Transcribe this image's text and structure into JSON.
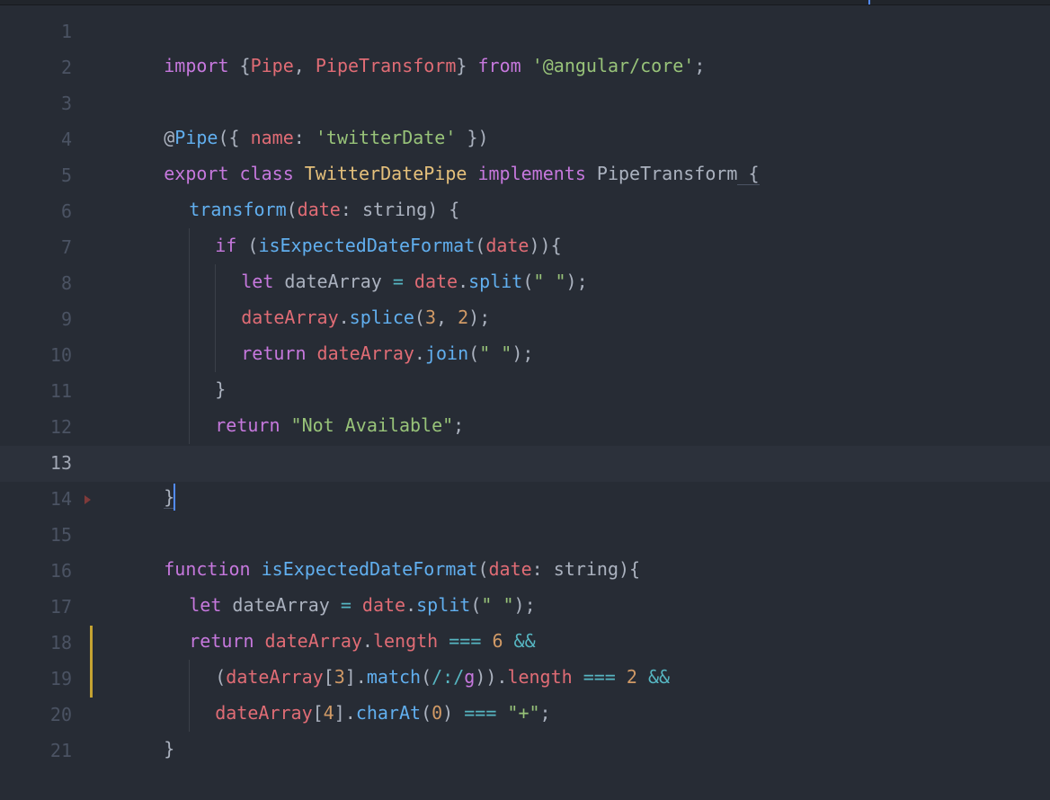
{
  "code": {
    "line_numbers": [
      "1",
      "2",
      "3",
      "4",
      "5",
      "6",
      "7",
      "8",
      "9",
      "10",
      "11",
      "12",
      "13",
      "14",
      "15",
      "16",
      "17",
      "18",
      "19",
      "20",
      "21"
    ],
    "active_line": 13,
    "lines": {
      "l1": {
        "import": "import",
        "lb": " {",
        "Pipe": "Pipe",
        "comma": ", ",
        "PipeTransform": "PipeTransform",
        "rb": "} ",
        "from": "from",
        "sp": " ",
        "str": "'@angular/core'",
        "semi": ";"
      },
      "l3": {
        "at": "@",
        "Pipe": "Pipe",
        "lp": "({ ",
        "name_kw": "name",
        "colon": ": ",
        "str": "'twitterDate'",
        "rp": " })"
      },
      "l4": {
        "export": "export",
        "class": " class ",
        "ClassName": "TwitterDatePipe",
        "implements": " implements ",
        "Iface": "PipeTransform",
        "lb": " {"
      },
      "l5": {
        "fn": "transform",
        "lp": "(",
        "arg": "date",
        "colon": ": ",
        "type": "string",
        "rp": ") {"
      },
      "l6": {
        "if": "if",
        "lp": " (",
        "fn": "isExpectedDateFormat",
        "lp2": "(",
        "arg": "date",
        "rp2": ")",
        "rp": "){"
      },
      "l7": {
        "let": "let",
        "var": " dateArray",
        "eq": " = ",
        "obj": "date",
        "dot": ".",
        "fn": "split",
        "lp": "(",
        "str": "\" \"",
        "rp": ");"
      },
      "l8": {
        "obj": "dateArray",
        "dot": ".",
        "fn": "splice",
        "lp": "(",
        "n1": "3",
        "comma": ", ",
        "n2": "2",
        "rp": ");"
      },
      "l9": {
        "return": "return",
        "obj": " dateArray",
        "dot": ".",
        "fn": "join",
        "lp": "(",
        "str": "\" \"",
        "rp": ");"
      },
      "l10": {
        "rb": "}"
      },
      "l11": {
        "return": "return",
        "sp": " ",
        "str": "\"Not Available\"",
        "semi": ";"
      },
      "l12": {
        "rb": "}"
      },
      "l13": {
        "rb": "}"
      },
      "l15": {
        "function": "function",
        "name": " isExpectedDateFormat",
        "lp": "(",
        "arg": "date",
        "colon": ": ",
        "type": "string",
        "rp": "){"
      },
      "l16": {
        "let": "let",
        "var": " dateArray",
        "eq": " = ",
        "obj": "date",
        "dot": ".",
        "fn": "split",
        "lp": "(",
        "str": "\" \"",
        "rp": ");"
      },
      "l17": {
        "return": "return",
        "obj": " dateArray",
        "dot": ".",
        "prop": "length",
        "eqeq": " === ",
        "n": "6",
        "and": " &&"
      },
      "l18": {
        "lp": "(",
        "obj": "dateArray",
        "lb": "[",
        "idx": "3",
        "rb": "].",
        "fn": "match",
        "lp2": "(",
        "regex_s": "/",
        "regex_b": ":",
        "regex_e": "/",
        "flags": "g",
        "rp2": ")).",
        "prop": "length",
        "eqeq": " === ",
        "n": "2",
        "and": " &&"
      },
      "l19": {
        "obj": "dateArray",
        "lb": "[",
        "idx": "4",
        "rb": "].",
        "fn": "charAt",
        "lp": "(",
        "n": "0",
        "rp": ")",
        "eqeq": " === ",
        "str": "\"+\"",
        "semi": ";"
      },
      "l20": {
        "rb": "}"
      }
    }
  }
}
